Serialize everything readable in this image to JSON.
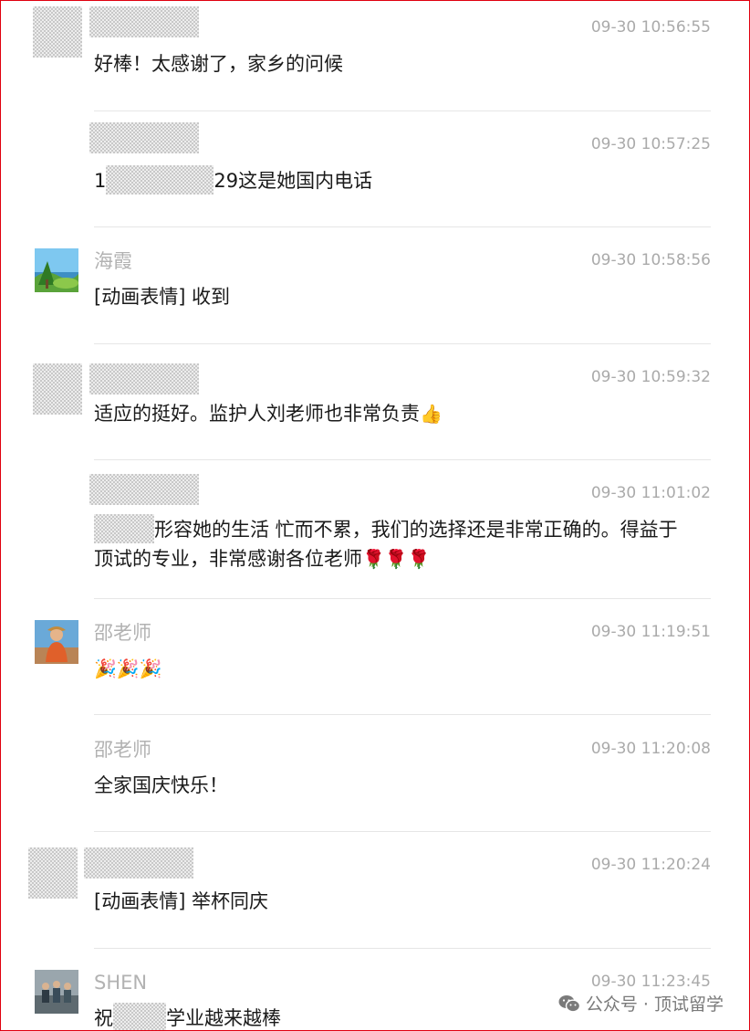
{
  "messages": [
    {
      "name": "",
      "time": "09-30 10:56:55",
      "text": "好棒！太感谢了，家乡的问候"
    },
    {
      "name": "",
      "time": "09-30 10:57:25",
      "text_prefix": "1",
      "text_suffix": "29这是她国内电话"
    },
    {
      "name": "海霞",
      "time": "09-30 10:58:56",
      "text": "[动画表情] 收到"
    },
    {
      "name": "",
      "time": "09-30 10:59:32",
      "text": "适应的挺好。监护人刘老师也非常负责",
      "emoji": "👍"
    },
    {
      "name": "",
      "time": "09-30 11:01:02",
      "text_suffix": "形容她的生活 忙而不累，我们的选择还是非常正确的。得益于顶试的专业，非常感谢各位老师",
      "emoji": "🌹🌹🌹"
    },
    {
      "name": "邵老师",
      "time": "09-30 11:19:51",
      "emoji": "🎉🎉🎉"
    },
    {
      "name": "邵老师",
      "time": "09-30 11:20:08",
      "text": "全家国庆快乐！"
    },
    {
      "name": "",
      "time": "09-30 11:20:24",
      "text": "[动画表情] 举杯同庆"
    },
    {
      "name": "SHEN",
      "time": "09-30 11:23:45",
      "text_prefix": "祝",
      "text_suffix": "学业越来越棒"
    }
  ],
  "watermark": {
    "text": "公众号 · 顶试留学",
    "icon": "wechat-icon"
  },
  "colors": {
    "border": "#e0000f",
    "name": "#b2b2b2",
    "time": "#aaaaaa",
    "divider": "#e6e6e6"
  }
}
